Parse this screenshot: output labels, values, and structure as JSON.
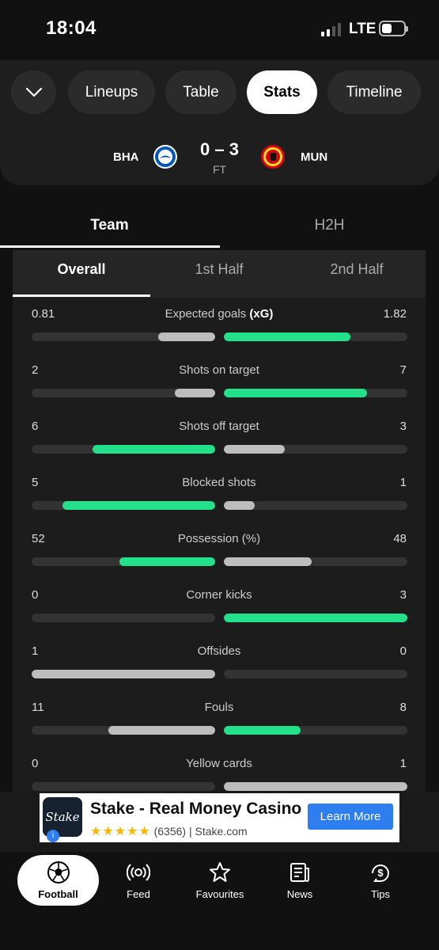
{
  "status": {
    "time": "18:04",
    "network": "LTE"
  },
  "header": {
    "tabs": [
      "Lineups",
      "Table",
      "Stats",
      "Timeline"
    ],
    "active_tab": "Stats",
    "home_code": "BHA",
    "away_code": "MUN",
    "score": "0 – 3",
    "status": "FT"
  },
  "team_tabs": [
    "Team",
    "H2H"
  ],
  "period_tabs": [
    "Overall",
    "1st Half",
    "2nd Half"
  ],
  "colors": {
    "accent": "#23e08a",
    "neutral": "#bdbdbd",
    "track": "#333333"
  },
  "stats": [
    {
      "label": "Expected goals (xG)",
      "home": "0.81",
      "away": "1.82",
      "home_frac": 0.31,
      "away_frac": 0.69,
      "leader": "away"
    },
    {
      "label": "Shots on target",
      "home": "2",
      "away": "7",
      "home_frac": 0.22,
      "away_frac": 0.78,
      "leader": "away"
    },
    {
      "label": "Shots off target",
      "home": "6",
      "away": "3",
      "home_frac": 0.67,
      "away_frac": 0.33,
      "leader": "home"
    },
    {
      "label": "Blocked shots",
      "home": "5",
      "away": "1",
      "home_frac": 0.83,
      "away_frac": 0.17,
      "leader": "home"
    },
    {
      "label": "Possession (%)",
      "home": "52",
      "away": "48",
      "home_frac": 0.52,
      "away_frac": 0.48,
      "leader": "home"
    },
    {
      "label": "Corner kicks",
      "home": "0",
      "away": "3",
      "home_frac": 0.0,
      "away_frac": 1.0,
      "leader": "away"
    },
    {
      "label": "Offsides",
      "home": "1",
      "away": "0",
      "home_frac": 1.0,
      "away_frac": 0.0,
      "leader": "none"
    },
    {
      "label": "Fouls",
      "home": "11",
      "away": "8",
      "home_frac": 0.58,
      "away_frac": 0.42,
      "leader": "away"
    },
    {
      "label": "Yellow cards",
      "home": "0",
      "away": "1",
      "home_frac": 0.0,
      "away_frac": 1.0,
      "leader": "none"
    }
  ],
  "ad": {
    "logo_text": "Stake",
    "title": "Stake - Real Money Casino",
    "rating_count": "(6356)",
    "domain": "Stake.com",
    "stars": "★★★★★",
    "cta": "Learn More",
    "info_icon": "i"
  },
  "nav": [
    {
      "label": "Football",
      "icon": "football-icon",
      "active": true
    },
    {
      "label": "Feed",
      "icon": "feed-icon",
      "active": false
    },
    {
      "label": "Favourites",
      "icon": "star-icon",
      "active": false
    },
    {
      "label": "News",
      "icon": "news-icon",
      "active": false
    },
    {
      "label": "Tips",
      "icon": "tips-icon",
      "active": false
    }
  ]
}
